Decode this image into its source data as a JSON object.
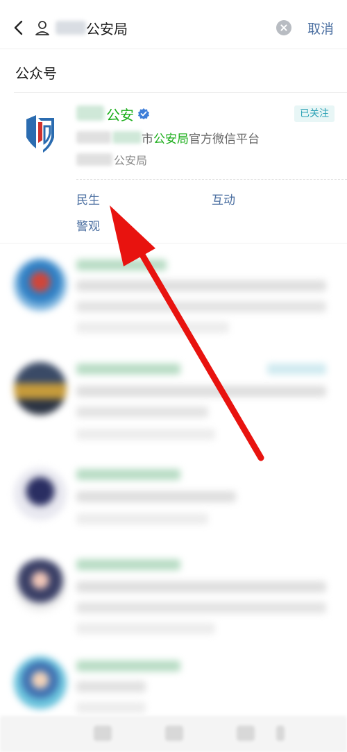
{
  "search": {
    "query_suffix": "公安局",
    "cancel_label": "取消"
  },
  "section": {
    "title": "公众号"
  },
  "account": {
    "name_suffix": "公安",
    "follow_status": "已关注",
    "description_prefix": "市",
    "description_highlight": "公安局",
    "description_suffix": "官方微信平台",
    "owner_suffix": "公安局",
    "menu": [
      "民生",
      "互动",
      "警观"
    ]
  },
  "colors": {
    "accent_green": "#1aad19",
    "link_blue": "#4a6ea0",
    "arrow_red": "#e8130f"
  }
}
